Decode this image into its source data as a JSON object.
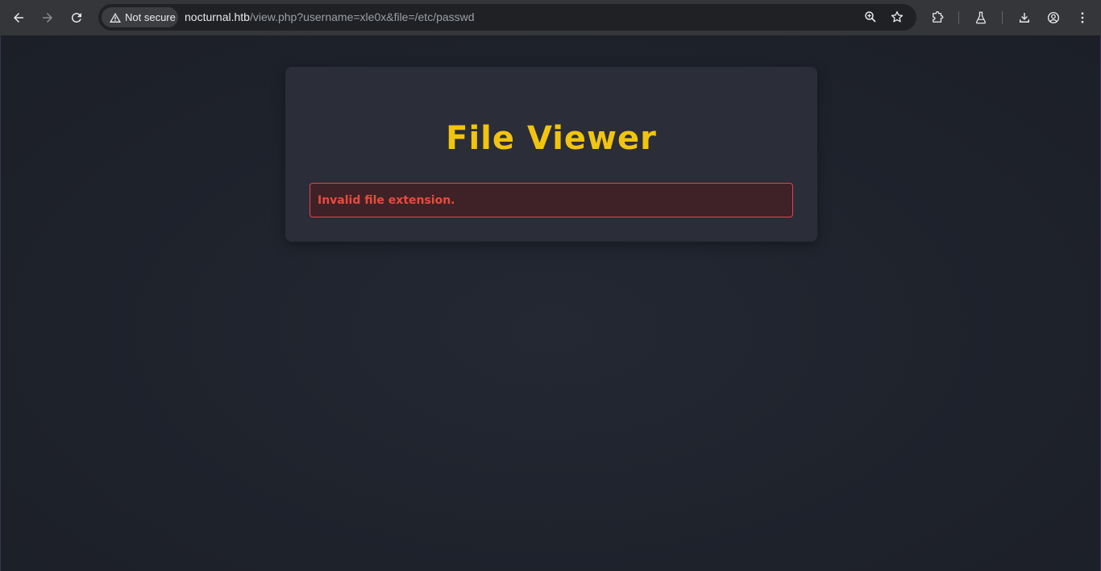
{
  "browser": {
    "security_label": "Not secure",
    "url_host": "nocturnal.htb",
    "url_rest": "/view.php?username=xle0x&file=/etc/passwd",
    "icons": {
      "back": "back-arrow-icon",
      "forward": "forward-arrow-icon",
      "reload": "reload-icon",
      "warning": "warning-triangle-icon",
      "zoom": "zoom-icon",
      "bookmark": "star-icon",
      "extensions": "puzzle-icon",
      "labs": "flask-icon",
      "downloads": "download-icon",
      "profile": "profile-icon",
      "menu": "kebab-menu-icon"
    }
  },
  "page": {
    "title": "File Viewer",
    "error_message": "Invalid file extension."
  },
  "colors": {
    "title": "#f1c40f",
    "error_text": "#e74c3c",
    "error_border": "#e0474c",
    "error_bg": "#3f2227",
    "card_bg": "#2b2d39",
    "page_bg": "#1f232c"
  }
}
